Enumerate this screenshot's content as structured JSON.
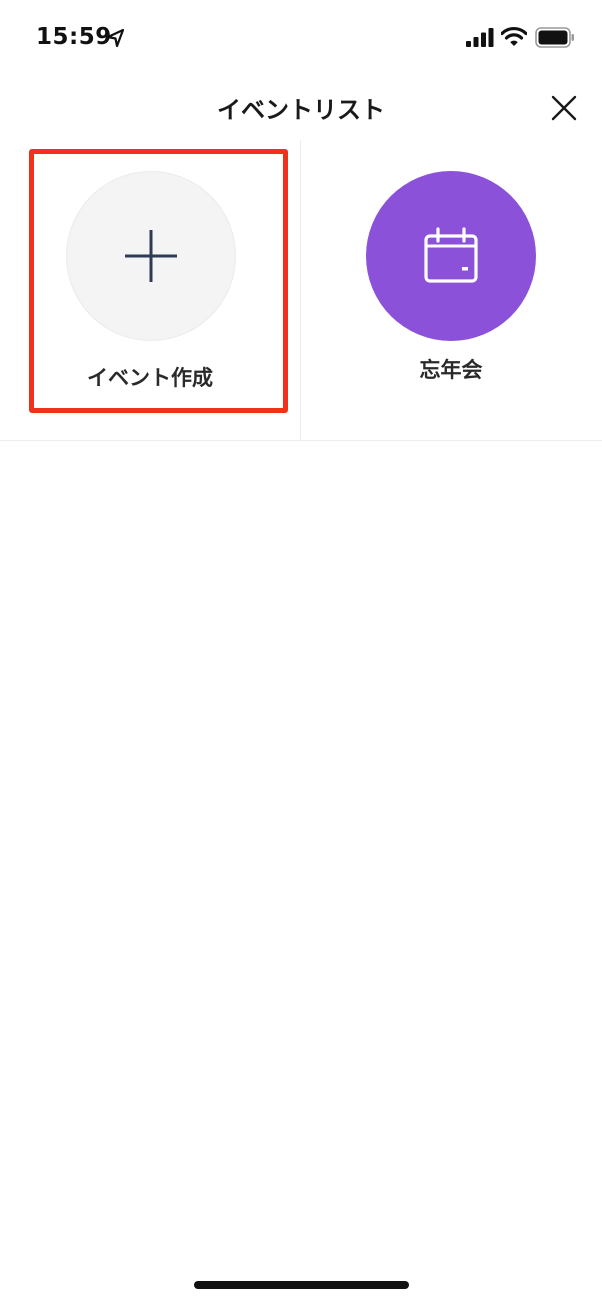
{
  "status_bar": {
    "time": "15:59",
    "icons": [
      "location-arrow-icon",
      "signal-icon",
      "wifi-icon",
      "battery-icon"
    ]
  },
  "header": {
    "title": "イベントリスト",
    "close_icon": "close-icon"
  },
  "events": [
    {
      "label": "イベント作成",
      "icon": "plus-icon",
      "circle_color": "#f4f4f5",
      "highlighted": true
    },
    {
      "label": "忘年会",
      "icon": "calendar-icon",
      "circle_color": "#8b52d9",
      "highlighted": false
    }
  ],
  "colors": {
    "accent_purple": "#8b52d9",
    "highlight_red": "#f2301b",
    "plus_stroke": "#2f3a55"
  }
}
